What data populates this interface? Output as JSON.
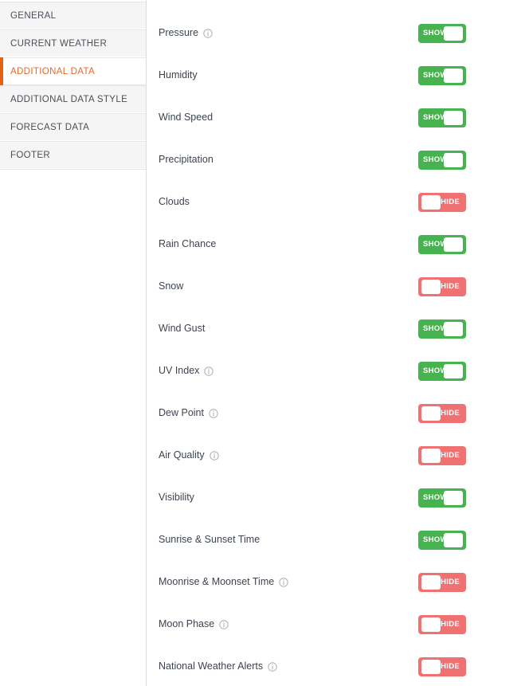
{
  "sidebar": {
    "items": [
      {
        "label": "GENERAL",
        "active": false
      },
      {
        "label": "CURRENT WEATHER",
        "active": false
      },
      {
        "label": "ADDITIONAL DATA",
        "active": true
      },
      {
        "label": "ADDITIONAL DATA STYLE",
        "active": false
      },
      {
        "label": "FORECAST DATA",
        "active": false
      },
      {
        "label": "FOOTER",
        "active": false
      }
    ]
  },
  "toggle_labels": {
    "on": "SHOW",
    "off": "HIDE"
  },
  "colors": {
    "accent": "#e8610f",
    "accent_text": "#e8682a",
    "toggle_on": "#47b34f",
    "toggle_off": "#ef7171",
    "sidebar_bg": "#f5f5f5",
    "label_text": "#3c4450"
  },
  "icons": {
    "info": "info-circle-icon"
  },
  "settings": {
    "rows": [
      {
        "label": "Pressure",
        "info": true,
        "state": "SHOW",
        "on": true
      },
      {
        "label": "Humidity",
        "info": false,
        "state": "SHOW",
        "on": true
      },
      {
        "label": "Wind Speed",
        "info": false,
        "state": "SHOW",
        "on": true
      },
      {
        "label": "Precipitation",
        "info": false,
        "state": "SHOW",
        "on": true
      },
      {
        "label": "Clouds",
        "info": false,
        "state": "HIDE",
        "on": false
      },
      {
        "label": "Rain Chance",
        "info": false,
        "state": "SHOW",
        "on": true
      },
      {
        "label": "Snow",
        "info": false,
        "state": "HIDE",
        "on": false
      },
      {
        "label": "Wind Gust",
        "info": false,
        "state": "SHOW",
        "on": true
      },
      {
        "label": "UV Index",
        "info": true,
        "state": "SHOW",
        "on": true
      },
      {
        "label": "Dew Point",
        "info": true,
        "state": "HIDE",
        "on": false
      },
      {
        "label": "Air Quality",
        "info": true,
        "state": "HIDE",
        "on": false
      },
      {
        "label": "Visibility",
        "info": false,
        "state": "SHOW",
        "on": true
      },
      {
        "label": "Sunrise & Sunset Time",
        "info": false,
        "state": "SHOW",
        "on": true
      },
      {
        "label": "Moonrise & Moonset Time",
        "info": true,
        "state": "HIDE",
        "on": false
      },
      {
        "label": "Moon Phase",
        "info": true,
        "state": "HIDE",
        "on": false
      },
      {
        "label": "National Weather Alerts",
        "info": true,
        "state": "HIDE",
        "on": false
      }
    ]
  }
}
